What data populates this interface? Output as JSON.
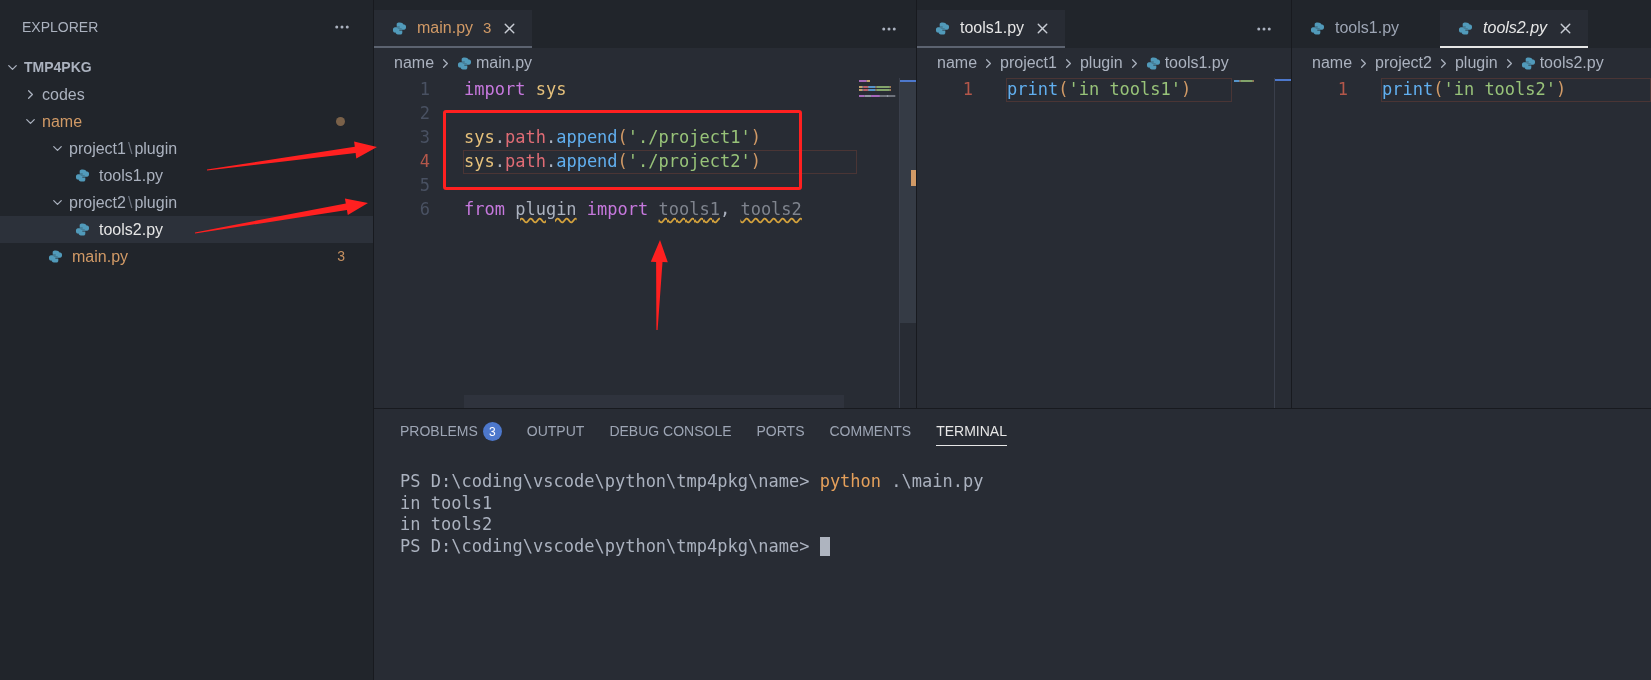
{
  "sidebar": {
    "title": "EXPLORER",
    "root": {
      "label": "TMP4PKG",
      "expanded": true,
      "children": [
        {
          "label": "codes",
          "kind": "folder",
          "expanded": false,
          "selected": false,
          "problems": false
        },
        {
          "label": "name",
          "kind": "folder",
          "expanded": true,
          "selected": false,
          "problems": true,
          "children": [
            {
              "segments": [
                "project1",
                "plugin"
              ],
              "separator": "\\",
              "kind": "folder",
              "expanded": true,
              "selected": false,
              "problems": false,
              "children": [
                {
                  "label": "tools1.py",
                  "kind": "file",
                  "selected": false,
                  "problems": false
                }
              ]
            },
            {
              "segments": [
                "project2",
                "plugin"
              ],
              "separator": "\\",
              "kind": "folder",
              "expanded": true,
              "selected": false,
              "problems": false,
              "children": [
                {
                  "label": "tools2.py",
                  "kind": "file",
                  "selected": true,
                  "problems": false
                }
              ]
            },
            {
              "label": "main.py",
              "kind": "file",
              "selected": false,
              "problems": true,
              "badge": "3"
            }
          ]
        }
      ]
    }
  },
  "editors": [
    {
      "focused": false,
      "actions_menu": true,
      "minimap": true,
      "tabs": [
        {
          "label": "main.py",
          "selected": true,
          "preview": false,
          "problems": true,
          "badge": "3"
        }
      ],
      "breadcrumb": [
        {
          "label": "name",
          "kind": "folder"
        },
        {
          "label": "main.py",
          "kind": "file"
        }
      ],
      "lines": [
        {
          "number": "1",
          "current": false,
          "tokens": [
            {
              "text": "import ",
              "kind": "keyword"
            },
            {
              "text": "sys",
              "kind": "variable"
            }
          ]
        },
        {
          "number": "2",
          "current": false
        },
        {
          "number": "3",
          "current": false,
          "tokens": [
            {
              "text": "sys",
              "kind": "variable"
            },
            {
              "text": ".",
              "kind": "punct"
            },
            {
              "text": "path",
              "kind": "property"
            },
            {
              "text": ".",
              "kind": "punct"
            },
            {
              "text": "append",
              "kind": "function"
            },
            {
              "text": "(",
              "kind": "bracket"
            },
            {
              "text": "'./project1'",
              "kind": "string"
            },
            {
              "text": ")",
              "kind": "bracket"
            }
          ]
        },
        {
          "number": "4",
          "current": true,
          "tokens": [
            {
              "text": "sys",
              "kind": "variable"
            },
            {
              "text": ".",
              "kind": "punct"
            },
            {
              "text": "path",
              "kind": "property"
            },
            {
              "text": ".",
              "kind": "punct"
            },
            {
              "text": "append",
              "kind": "function"
            },
            {
              "text": "(",
              "kind": "bracket"
            },
            {
              "text": "'./project2'",
              "kind": "string"
            },
            {
              "text": ")",
              "kind": "bracket"
            }
          ]
        },
        {
          "number": "5",
          "current": false
        },
        {
          "number": "6",
          "current": false,
          "tokens": [
            {
              "text": "from ",
              "kind": "keyword"
            },
            {
              "text": "plugin",
              "kind": "unresolved"
            },
            {
              "text": " import ",
              "kind": "keyword"
            },
            {
              "text": "tools1",
              "kind": "unused"
            },
            {
              "text": ", ",
              "kind": "punct"
            },
            {
              "text": "tools2",
              "kind": "unused"
            }
          ]
        }
      ]
    },
    {
      "focused": false,
      "actions_menu": true,
      "minimap": true,
      "tabs": [
        {
          "label": "tools1.py",
          "selected": true,
          "preview": false,
          "problems": false
        }
      ],
      "breadcrumb": [
        {
          "label": "name",
          "kind": "folder"
        },
        {
          "label": "project1",
          "kind": "folder"
        },
        {
          "label": "plugin",
          "kind": "folder"
        },
        {
          "label": "tools1.py",
          "kind": "file"
        }
      ],
      "lines": [
        {
          "number": "1",
          "current": true,
          "tokens": [
            {
              "text": "print",
              "kind": "function"
            },
            {
              "text": "(",
              "kind": "bracket"
            },
            {
              "text": "'in tools1'",
              "kind": "string"
            },
            {
              "text": ")",
              "kind": "bracket"
            }
          ]
        }
      ]
    },
    {
      "focused": true,
      "actions_menu": false,
      "minimap": false,
      "tabs": [
        {
          "label": "tools1.py",
          "selected": false,
          "preview": false,
          "problems": false
        },
        {
          "label": "tools2.py",
          "selected": true,
          "preview": true,
          "problems": false
        }
      ],
      "breadcrumb": [
        {
          "label": "name",
          "kind": "folder"
        },
        {
          "label": "project2",
          "kind": "folder"
        },
        {
          "label": "plugin",
          "kind": "folder"
        },
        {
          "label": "tools2.py",
          "kind": "file"
        }
      ],
      "lines": [
        {
          "number": "1",
          "current": true,
          "tokens": [
            {
              "text": "print",
              "kind": "function"
            },
            {
              "text": "(",
              "kind": "bracket"
            },
            {
              "text": "'in tools2'",
              "kind": "string"
            },
            {
              "text": ")",
              "kind": "bracket"
            }
          ]
        }
      ]
    }
  ],
  "panel": {
    "tabs": [
      {
        "label": "PROBLEMS",
        "selected": false,
        "badge": "3"
      },
      {
        "label": "OUTPUT",
        "selected": false
      },
      {
        "label": "DEBUG CONSOLE",
        "selected": false
      },
      {
        "label": "PORTS",
        "selected": false
      },
      {
        "label": "COMMENTS",
        "selected": false
      },
      {
        "label": "TERMINAL",
        "selected": true
      }
    ],
    "terminal": {
      "cursor": true,
      "lines": [
        {
          "segments": [
            {
              "text": "PS D:\\coding\\vscode\\python\\tmp4pkg\\name> ",
              "kind": "plain"
            },
            {
              "text": "python",
              "kind": "command"
            },
            {
              "text": " .\\main.py",
              "kind": "plain"
            }
          ]
        },
        {
          "segments": [
            {
              "text": "in tools1",
              "kind": "plain"
            }
          ]
        },
        {
          "segments": [
            {
              "text": "in tools2",
              "kind": "plain"
            }
          ]
        },
        {
          "segments": [
            {
              "text": "PS D:\\coding\\vscode\\python\\tmp4pkg\\name> ",
              "kind": "plain"
            }
          ]
        }
      ]
    }
  }
}
